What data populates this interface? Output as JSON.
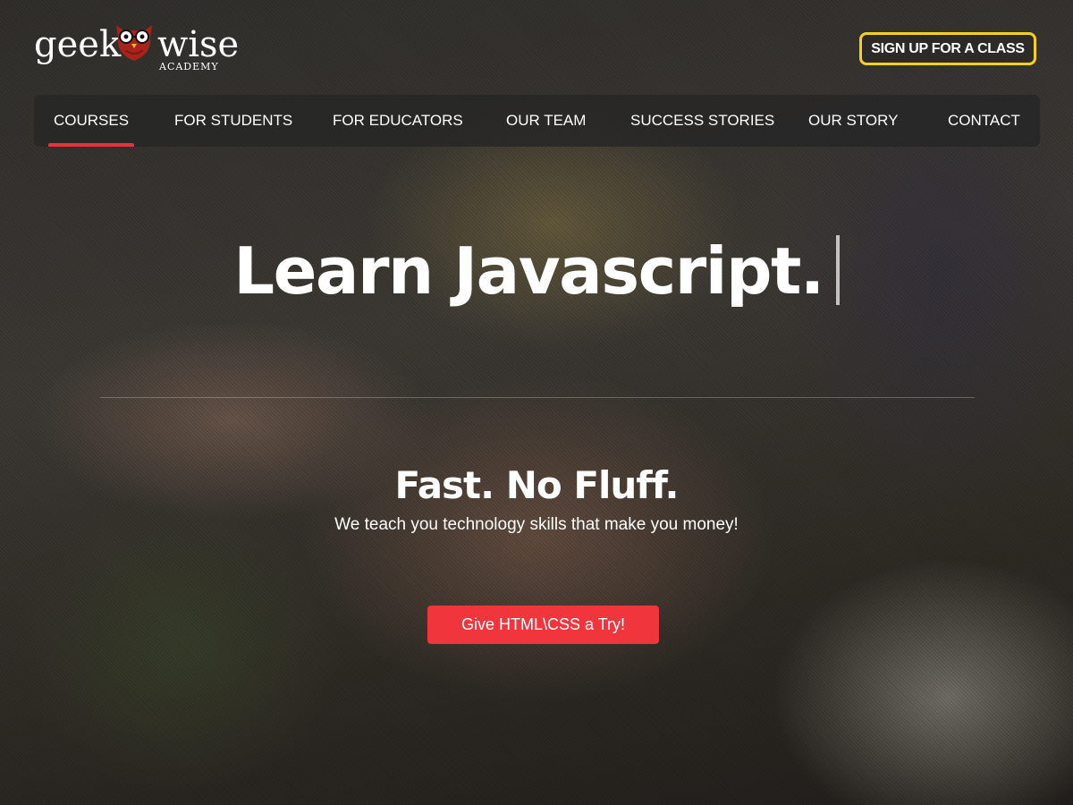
{
  "logo": {
    "left_word": "geek",
    "right_word": "wise",
    "sub": "ACADEMY",
    "mascot": "owl-icon",
    "mascot_color": "#a8231c"
  },
  "header": {
    "cta_label": "SIGN UP FOR A CLASS",
    "cta_border_color": "#f5d020"
  },
  "nav": {
    "items": [
      {
        "label": "COURSES",
        "active": true
      },
      {
        "label": "FOR STUDENTS",
        "active": false
      },
      {
        "label": "FOR EDUCATORS",
        "active": false
      },
      {
        "label": "OUR TEAM",
        "active": false
      },
      {
        "label": "SUCCESS STORIES",
        "active": false
      },
      {
        "label": "OUR STORY",
        "active": false
      },
      {
        "label": "CONTACT",
        "active": false
      }
    ],
    "active_indicator_color": "#e8323a"
  },
  "hero": {
    "headline": "Learn Javascript.",
    "tagline": "Fast. No Fluff.",
    "subline": "We teach you technology skills that make you money!",
    "button_label": "Give HTML\\CSS a Try!",
    "button_color": "#f0353c"
  }
}
